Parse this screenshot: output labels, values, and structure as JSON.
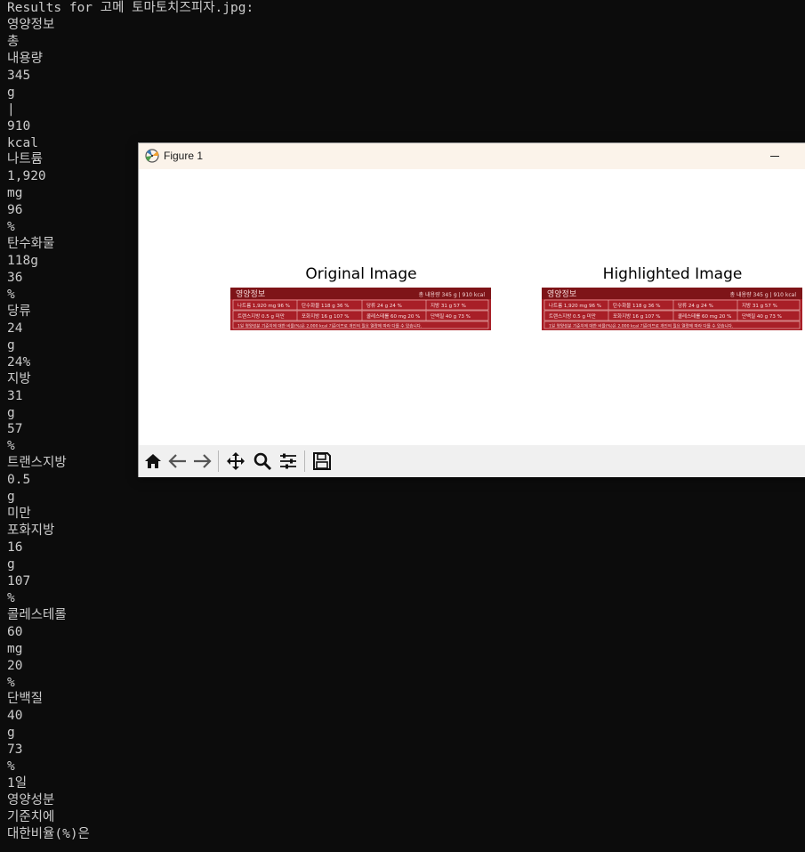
{
  "terminal": {
    "lines": [
      "Results for 고메 토마토치즈피자.jpg:",
      "영양정보",
      "총",
      "내용량",
      "345",
      "g",
      "|",
      "910",
      "kcal",
      "나트륨",
      "1,920",
      "mg",
      "96",
      "%",
      "탄수화물",
      "118g",
      "36",
      "%",
      "당류",
      "24",
      "g",
      "24%",
      "지방",
      "31",
      "g",
      "57",
      "%",
      "트랜스지방",
      "0.5",
      "g",
      "미만",
      "포화지방",
      "16",
      "g",
      "107",
      "%",
      "콜레스테롤",
      "60",
      "mg",
      "20",
      "%",
      "단백질",
      "40",
      "g",
      "73",
      "%",
      "1일",
      "영양성분",
      "기준치에",
      "대한비율(%)은"
    ]
  },
  "figure": {
    "window_title": "Figure 1",
    "icons": {
      "app": "matplotlib-app-icon",
      "minimize": "minimize-icon",
      "home": "home-icon",
      "back": "back-arrow-icon",
      "forward": "forward-arrow-icon",
      "pan": "pan-move-icon",
      "zoom": "zoom-magnifier-icon",
      "configure": "configure-subplots-icon",
      "save": "save-floppy-icon"
    },
    "subplots": [
      {
        "title": "Original Image",
        "label": {
          "header": "영양정보",
          "total": "총 내용량 345 g | 910 kcal",
          "row1": [
            "나트륨 1,920 mg 96 %",
            "탄수화물 118 g 36 %",
            "당류 24 g 24 %",
            "지방 31 g 57 %"
          ],
          "row2": [
            "트랜스지방 0.5 g 미만",
            "포화지방 16 g 107 %",
            "콜레스테롤 60 mg 20 %",
            "단백질 40 g 73 %"
          ],
          "footer": "1일 영양성분 기준치에 대한 비율(%)은 2,000 kcal 기준이므로 개인의 필요 열량에 따라 다를 수 있습니다."
        }
      },
      {
        "title": "Highlighted Image",
        "label": {
          "header": "영양정보",
          "total": "총 내용량 345 g | 910 kcal",
          "row1": [
            "나트륨 1,920 mg 96 %",
            "탄수화물 118 g 36 %",
            "당류 24 g 24 %",
            "지방 31 g 57 %"
          ],
          "row2": [
            "트랜스지방 0.5 g 미만",
            "포화지방 16 g 107 %",
            "콜레스테롤 60 mg 20 %",
            "단백질 40 g 73 %"
          ],
          "footer": "1일 영양성분 기준치에 대한 비율(%)은 2,000 kcal 기준이므로 개인의 필요 열량에 따라 다를 수 있습니다."
        }
      }
    ]
  },
  "colors": {
    "terminal_bg": "#0c0c0c",
    "terminal_text": "#cccccc",
    "label_red": "#b4232b",
    "label_dark": "#7e1418",
    "titlebar_bg": "#fbf3ea",
    "toolbar_bg": "#f0f0f0"
  }
}
